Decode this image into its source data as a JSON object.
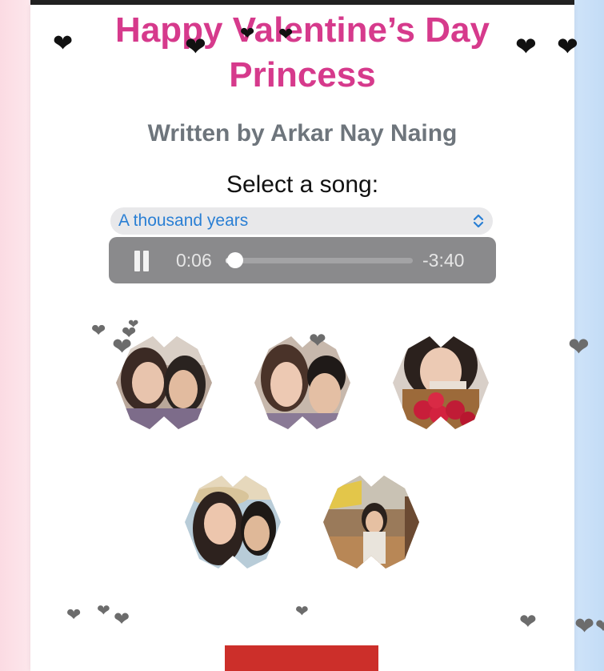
{
  "page": {
    "title_line1": "Happy Valentine’s Day",
    "title_line2": "Princess",
    "subtitle": "Written by Arkar Nay Naing",
    "select_label": "Select a song:"
  },
  "song_select": {
    "selected": "A thousand years"
  },
  "player": {
    "state": "playing",
    "current_time": "0:06",
    "remaining_time": "-3:40",
    "progress_fraction": 0.025
  },
  "photos": [
    {
      "name": "photo-1",
      "description_icon": "couple-selfie-photo"
    },
    {
      "name": "photo-2",
      "description_icon": "couple-selfie-photo"
    },
    {
      "name": "photo-3",
      "description_icon": "girl-with-roses-photo"
    },
    {
      "name": "photo-4",
      "description_icon": "couple-selfie-photo"
    },
    {
      "name": "photo-5",
      "description_icon": "girl-mirror-selfie-photo"
    }
  ],
  "colors": {
    "title": "#d63a8c",
    "subtitle": "#6e757c",
    "select_text": "#2a7fd4",
    "player_bg": "#8a8a8c",
    "button_red": "#cc2f2a",
    "heart_dark": "#111111",
    "heart_gray": "#6c6c6c"
  },
  "icons": {
    "heart": "❤",
    "pause": "pause-icon",
    "chevron": "chevron-up-down-icon"
  }
}
